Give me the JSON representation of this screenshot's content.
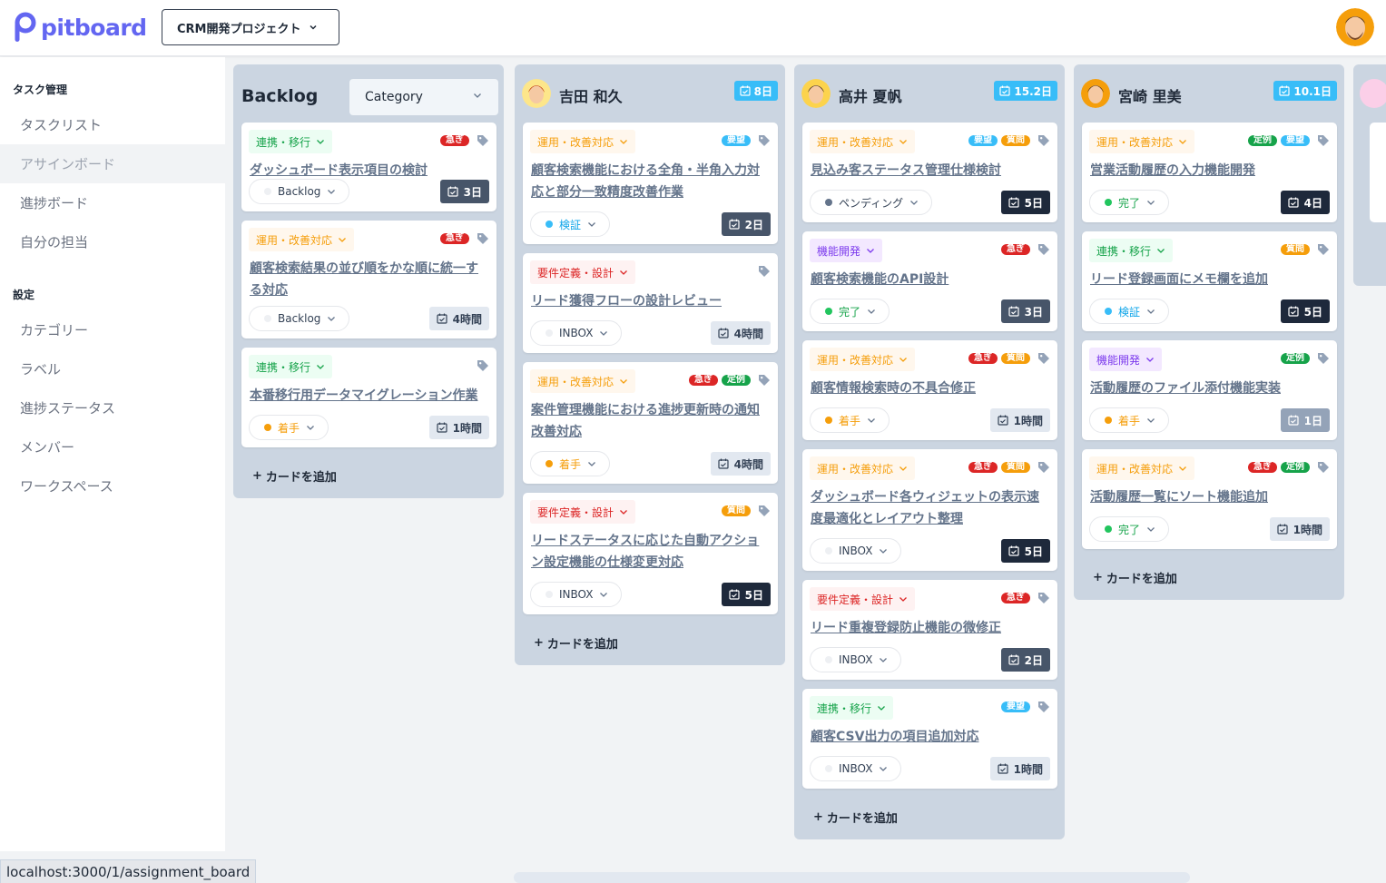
{
  "app": {
    "logo": "pitboard",
    "project": "CRM開発プロジェクト"
  },
  "sidebar": {
    "sections": [
      {
        "title": "タスク管理",
        "items": [
          "タスクリスト",
          "アサインボード",
          "進捗ボード",
          "自分の担当"
        ]
      },
      {
        "title": "設定",
        "items": [
          "カテゴリー",
          "ラベル",
          "進捗ステータス",
          "メンバー",
          "ワークスペース"
        ]
      }
    ],
    "active_item": "アサインボード"
  },
  "status_bar": {
    "url": "localhost:3000/1/assignment_board"
  },
  "add_card_label": "カードを追加",
  "colors": {
    "brand": "#6366f1",
    "column_bg": "#cbd5e1",
    "total_badge": "#38bdf8",
    "urgent": "#dc2626",
    "request": "#38bdf8",
    "question": "#f59e0b",
    "regular": "#16a34a"
  },
  "columns": [
    {
      "title": "Backlog",
      "filter": "Category",
      "cards": [
        {
          "category": "連携・移行",
          "labels": [
            "急ぎ"
          ],
          "title": "ダッシュボード表示項目の検討",
          "status": "Backlog",
          "estimate": "3日"
        },
        {
          "category": "運用・改善対応",
          "labels": [
            "急ぎ"
          ],
          "title": "顧客検索結果の並び順をかな順に統一する対応",
          "status": "Backlog",
          "estimate": "4時間"
        },
        {
          "category": "連携・移行",
          "labels": [],
          "title": "本番移行用データマイグレーション作業",
          "status": "着手",
          "estimate": "1時間"
        }
      ]
    },
    {
      "name": "吉田 和久",
      "total": "8日",
      "cards": [
        {
          "category": "運用・改善対応",
          "labels": [
            "要望"
          ],
          "title": "顧客検索機能における全角・半角入力対応と部分一致精度改善作業",
          "status": "検証",
          "estimate": "2日"
        },
        {
          "category": "要件定義・設計",
          "labels": [],
          "title": "リード獲得フローの設計レビュー",
          "status": "INBOX",
          "estimate": "4時間"
        },
        {
          "category": "運用・改善対応",
          "labels": [
            "急ぎ",
            "定例"
          ],
          "title": "案件管理機能における進捗更新時の通知改善対応",
          "status": "着手",
          "estimate": "4時間"
        },
        {
          "category": "要件定義・設計",
          "labels": [
            "質問"
          ],
          "title": "リードステータスに応じた自動アクション設定機能の仕様変更対応",
          "status": "INBOX",
          "estimate": "5日"
        }
      ]
    },
    {
      "name": "高井 夏帆",
      "total": "15.2日",
      "cards": [
        {
          "category": "運用・改善対応",
          "labels": [
            "要望",
            "質問"
          ],
          "title": "見込み客ステータス管理仕様検討",
          "status": "ペンディング",
          "estimate": "5日"
        },
        {
          "category": "機能開発",
          "labels": [
            "急ぎ"
          ],
          "title": "顧客検索機能のAPI設計",
          "status": "完了",
          "estimate": "3日"
        },
        {
          "category": "運用・改善対応",
          "labels": [
            "急ぎ",
            "質問"
          ],
          "title": "顧客情報検索時の不具合修正",
          "status": "着手",
          "estimate": "1時間"
        },
        {
          "category": "運用・改善対応",
          "labels": [
            "急ぎ",
            "質問"
          ],
          "title": "ダッシュボード各ウィジェットの表示速度最適化とレイアウト整理",
          "status": "INBOX",
          "estimate": "5日"
        },
        {
          "category": "要件定義・設計",
          "labels": [
            "急ぎ"
          ],
          "title": "リード重複登録防止機能の微修正",
          "status": "INBOX",
          "estimate": "2日"
        },
        {
          "category": "連携・移行",
          "labels": [
            "要望"
          ],
          "title": "顧客CSV出力の項目追加対応",
          "status": "INBOX",
          "estimate": "1時間"
        }
      ]
    },
    {
      "name": "宮崎 里美",
      "total": "10.1日",
      "cards": [
        {
          "category": "運用・改善対応",
          "labels": [
            "定例",
            "要望"
          ],
          "title": "営業活動履歴の入力機能開発",
          "status": "完了",
          "estimate": "4日"
        },
        {
          "category": "連携・移行",
          "labels": [
            "質問"
          ],
          "title": "リード登録画面にメモ欄を追加",
          "status": "検証",
          "estimate": "5日"
        },
        {
          "category": "機能開発",
          "labels": [
            "定例"
          ],
          "title": "活動履歴のファイル添付機能実装",
          "status": "着手",
          "estimate": "1日"
        },
        {
          "category": "運用・改善対応",
          "labels": [
            "急ぎ",
            "定例"
          ],
          "title": "活動履歴一覧にソート機能追加",
          "status": "完了",
          "estimate": "1時間"
        }
      ]
    }
  ]
}
